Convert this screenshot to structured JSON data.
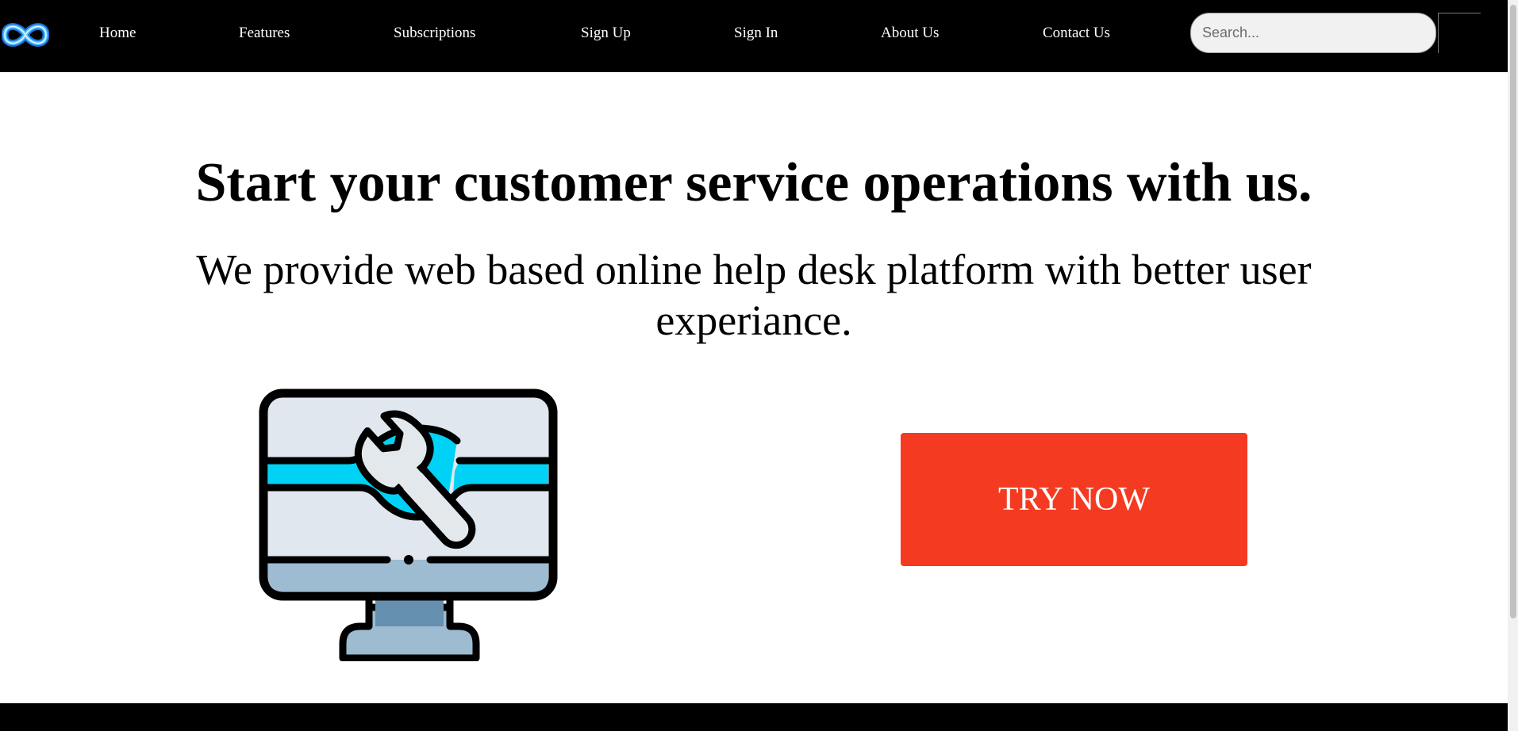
{
  "brand": {
    "logo_icon": "infinity-icon",
    "colors": {
      "nav_background": "#000000",
      "logo_glow": "#4fc3ff",
      "cta_background": "#f43b21",
      "illustration_accent": "#00d2f5",
      "screen_fill": "#e1e7ef",
      "stand_fill": "#9dbbd1"
    }
  },
  "nav": {
    "items": [
      {
        "label": "Home"
      },
      {
        "label": "Features"
      },
      {
        "label": "Subscriptions"
      },
      {
        "label": "Sign Up"
      },
      {
        "label": "Sign In"
      },
      {
        "label": "About Us"
      },
      {
        "label": "Contact Us"
      }
    ],
    "search": {
      "placeholder": "Search...",
      "value": ""
    }
  },
  "hero": {
    "title": "Start your customer service operations with us.",
    "subtitle": "We provide web based online help desk platform with better user experiance.",
    "illustration_icon": "computer-wrench-icon",
    "cta_label": "TRY NOW"
  }
}
